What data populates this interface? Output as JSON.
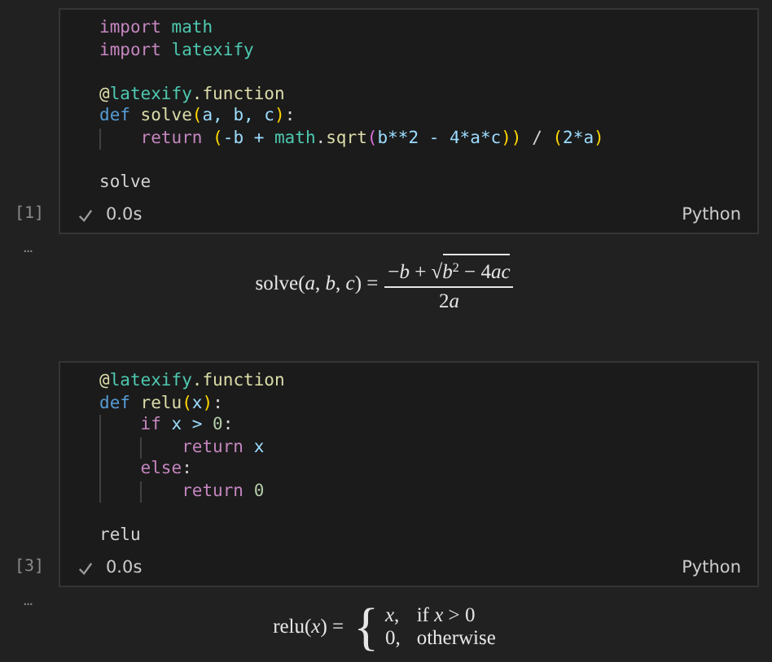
{
  "cells": [
    {
      "execution_count": "[1]",
      "duration": "0.0s",
      "language": "Python",
      "output_marker": "...",
      "lines": [
        {
          "kind": "code",
          "tokens": [
            {
              "text": "import",
              "kind": "keyword"
            },
            {
              "text": " math",
              "kind": "module"
            }
          ]
        },
        {
          "kind": "code",
          "tokens": [
            {
              "text": "import",
              "kind": "keyword"
            },
            {
              "text": " latexify",
              "kind": "module"
            }
          ]
        },
        {
          "kind": "blank"
        },
        {
          "kind": "code",
          "tokens": [
            {
              "text": "@",
              "kind": "decorator"
            },
            {
              "text": "latexify",
              "kind": "module"
            },
            {
              "text": ".function",
              "kind": "function"
            }
          ]
        },
        {
          "kind": "code",
          "tokens": [
            {
              "text": "def",
              "kind": "storage"
            },
            {
              "text": " solve",
              "kind": "function"
            },
            {
              "text": "(",
              "kind": "paren"
            },
            {
              "text": "a, b, c",
              "kind": "param"
            },
            {
              "text": ")",
              "kind": "paren"
            },
            {
              "text": ":",
              "kind": "plain"
            }
          ]
        },
        {
          "kind": "code",
          "tokens": [
            {
              "kind": "guide"
            },
            {
              "text": "return",
              "kind": "keyword"
            },
            {
              "text": " (",
              "kind": "paren"
            },
            {
              "text": "-b + ",
              "kind": "param"
            },
            {
              "text": "math",
              "kind": "module"
            },
            {
              "text": ".",
              "kind": "plain"
            },
            {
              "text": "sqrt",
              "kind": "function"
            },
            {
              "text": "(",
              "kind": "paren2"
            },
            {
              "text": "b**2 - 4*a*c",
              "kind": "param"
            },
            {
              "text": "))",
              "kind": "paren"
            },
            {
              "text": " / ",
              "kind": "plain"
            },
            {
              "text": "(",
              "kind": "paren"
            },
            {
              "text": "2*a",
              "kind": "param"
            },
            {
              "text": ")",
              "kind": "paren"
            }
          ]
        },
        {
          "kind": "blank"
        },
        {
          "kind": "code",
          "tokens": [
            {
              "text": "solve",
              "kind": "plain"
            }
          ]
        }
      ],
      "output": {
        "kind": "fraction",
        "lhs": [
          {
            "text": "solve(",
            "kind": "op"
          },
          {
            "text": "a",
            "kind": "var"
          },
          {
            "text": ", ",
            "kind": "op"
          },
          {
            "text": "b",
            "kind": "var"
          },
          {
            "text": ", ",
            "kind": "op"
          },
          {
            "text": "c",
            "kind": "var"
          },
          {
            "text": ") =",
            "kind": "op"
          }
        ],
        "numerator": [
          {
            "text": "−",
            "kind": "op"
          },
          {
            "text": "b",
            "kind": "var"
          },
          {
            "text": " + √",
            "kind": "op"
          }
        ],
        "radicand": [
          {
            "text": "b",
            "kind": "var"
          },
          {
            "text": "2",
            "kind": "sup"
          },
          {
            "text": " − 4",
            "kind": "op"
          },
          {
            "text": "ac",
            "kind": "var"
          }
        ],
        "denominator": [
          {
            "text": "2",
            "kind": "op"
          },
          {
            "text": "a",
            "kind": "var"
          }
        ]
      }
    },
    {
      "execution_count": "[3]",
      "duration": "0.0s",
      "language": "Python",
      "output_marker": "...",
      "lines": [
        {
          "kind": "code",
          "tokens": [
            {
              "text": "@",
              "kind": "decorator"
            },
            {
              "text": "latexify",
              "kind": "module"
            },
            {
              "text": ".function",
              "kind": "function"
            }
          ]
        },
        {
          "kind": "code",
          "tokens": [
            {
              "text": "def",
              "kind": "storage"
            },
            {
              "text": " relu",
              "kind": "function"
            },
            {
              "text": "(",
              "kind": "paren"
            },
            {
              "text": "x",
              "kind": "param"
            },
            {
              "text": ")",
              "kind": "paren"
            },
            {
              "text": ":",
              "kind": "plain"
            }
          ]
        },
        {
          "kind": "code",
          "tokens": [
            {
              "kind": "guide"
            },
            {
              "text": "if",
              "kind": "keyword"
            },
            {
              "text": " x > ",
              "kind": "param"
            },
            {
              "text": "0",
              "kind": "number"
            },
            {
              "text": ":",
              "kind": "plain"
            }
          ]
        },
        {
          "kind": "code",
          "tokens": [
            {
              "kind": "guide"
            },
            {
              "kind": "guide"
            },
            {
              "text": "return",
              "kind": "keyword"
            },
            {
              "text": " x",
              "kind": "param"
            }
          ]
        },
        {
          "kind": "code",
          "tokens": [
            {
              "kind": "guide"
            },
            {
              "text": "else",
              "kind": "keyword"
            },
            {
              "text": ":",
              "kind": "plain"
            }
          ]
        },
        {
          "kind": "code",
          "tokens": [
            {
              "kind": "guide"
            },
            {
              "kind": "guide"
            },
            {
              "text": "return",
              "kind": "keyword"
            },
            {
              "text": " 0",
              "kind": "number"
            }
          ]
        },
        {
          "kind": "blank"
        },
        {
          "kind": "code",
          "tokens": [
            {
              "text": "relu",
              "kind": "plain"
            }
          ]
        }
      ],
      "output": {
        "kind": "cases",
        "lhs": [
          {
            "text": "relu(",
            "kind": "op"
          },
          {
            "text": "x",
            "kind": "var"
          },
          {
            "text": ") =",
            "kind": "op"
          }
        ],
        "brace": "{",
        "cases": [
          {
            "value": [
              {
                "text": "x",
                "kind": "var"
              },
              {
                "text": ",",
                "kind": "op"
              }
            ],
            "condition": [
              {
                "text": "if ",
                "kind": "op"
              },
              {
                "text": "x",
                "kind": "var"
              },
              {
                "text": " > 0",
                "kind": "op"
              }
            ]
          },
          {
            "value": [
              {
                "text": "0,",
                "kind": "op"
              }
            ],
            "condition": [
              {
                "text": "otherwise",
                "kind": "op"
              }
            ]
          }
        ]
      }
    }
  ]
}
